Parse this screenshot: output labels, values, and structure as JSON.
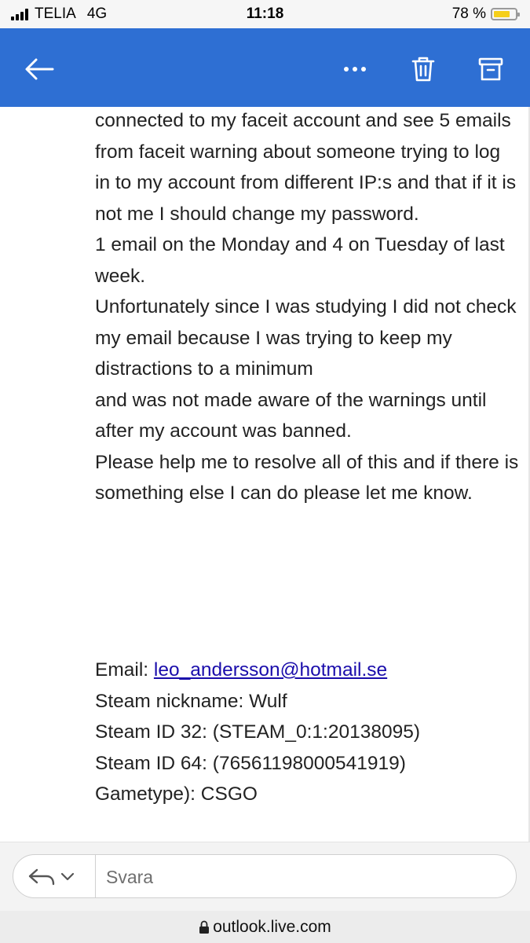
{
  "status_bar": {
    "carrier": "TELIA",
    "network": "4G",
    "time": "11:18",
    "battery_percent": "78 %",
    "battery_level": 0.78
  },
  "header": {
    "background": "#2e6fd3",
    "icons": [
      "back-arrow-icon",
      "more-icon",
      "trash-icon",
      "archive-icon"
    ]
  },
  "message": {
    "lines": [
      "connected to my faceit account and see 5 emails from faceit warning about someone trying to log in to my account from different IP:s and that if it is not me I should change my password.",
      "1 email on the Monday and 4 on Tuesday of last week.",
      "Unfortunately since I was studying I did not check my email because I was trying to keep my distractions to a minimum",
      "and was not made aware of the warnings until after my account was banned.",
      "Please help me to resolve all of this and if there is something else I can do please let me know."
    ],
    "signature": {
      "email_label": "Email:",
      "email_value": "leo_andersson@hotmail.se",
      "steam_nickname": "Steam nickname: Wulf",
      "steam_id_32": "Steam ID 32: (STEAM_0:1:20138095)",
      "steam_id_64": "Steam ID 64: (76561198000541919)",
      "gametype": "Gametype): CSGO"
    }
  },
  "reply": {
    "placeholder": "Svara"
  },
  "browser": {
    "url": "outlook.live.com"
  }
}
